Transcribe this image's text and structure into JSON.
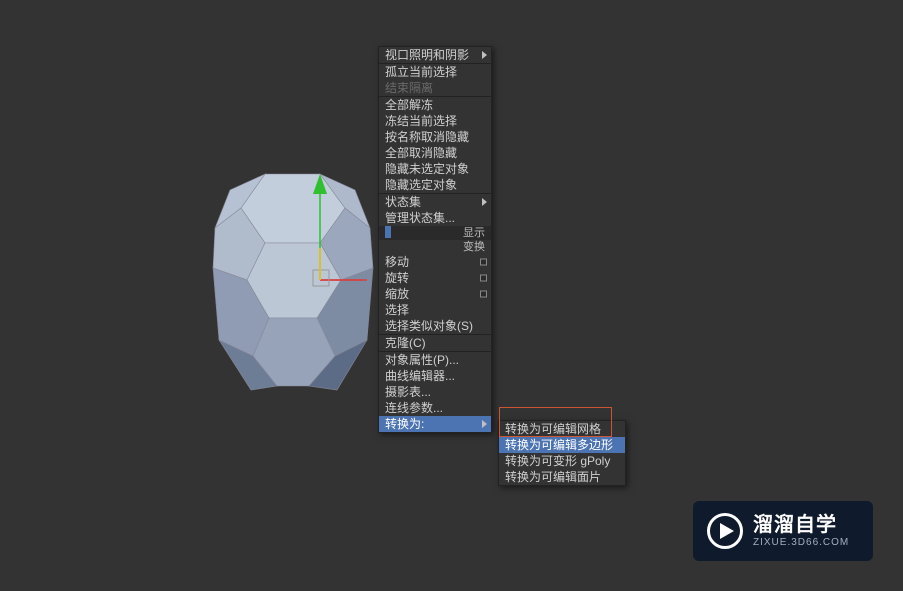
{
  "menu": {
    "main": [
      {
        "label": "视口照明和阴影",
        "arrow": true
      },
      {
        "sep": true
      },
      {
        "label": "孤立当前选择"
      },
      {
        "label": "结束隔离",
        "disabled": true
      },
      {
        "sep": true
      },
      {
        "label": "全部解冻"
      },
      {
        "label": "冻结当前选择"
      },
      {
        "label": "按名称取消隐藏"
      },
      {
        "label": "全部取消隐藏"
      },
      {
        "label": "隐藏未选定对象"
      },
      {
        "label": "隐藏选定对象"
      },
      {
        "sep": true
      },
      {
        "label": "状态集",
        "arrow": true
      },
      {
        "label": "管理状态集..."
      },
      {
        "header": "显示",
        "blue": true
      },
      {
        "header": "变换"
      },
      {
        "label": "移动",
        "mark": true
      },
      {
        "label": "旋转",
        "mark": true
      },
      {
        "label": "缩放",
        "mark": true
      },
      {
        "label": "选择"
      },
      {
        "label": "选择类似对象(S)"
      },
      {
        "sep": true
      },
      {
        "label": "克隆(C)"
      },
      {
        "sep": true
      },
      {
        "label": "对象属性(P)..."
      },
      {
        "label": "曲线编辑器..."
      },
      {
        "label": "摄影表..."
      },
      {
        "label": "连线参数..."
      },
      {
        "label": "转换为:",
        "arrow": true,
        "highlight": true
      }
    ],
    "sub": [
      {
        "label": "转换为可编辑网格"
      },
      {
        "label": "转换为可编辑多边形",
        "highlight": true
      },
      {
        "label": "转换为可变形 gPoly"
      },
      {
        "label": "转换为可编辑面片"
      }
    ]
  },
  "watermark": {
    "cn": "溜溜自学",
    "en": "ZIXUE.3D66.COM"
  }
}
